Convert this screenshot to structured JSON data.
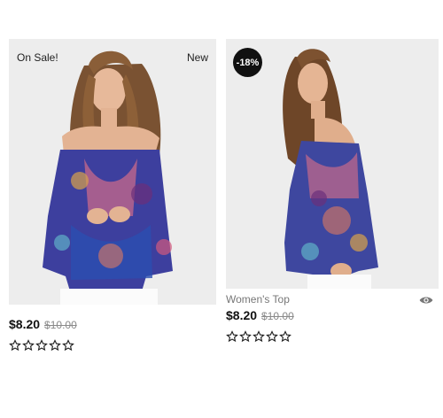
{
  "products": [
    {
      "badge_left": "On Sale!",
      "badge_right": "New",
      "title": "",
      "price": "$8.20",
      "old_price": "$10.00",
      "rating": 0,
      "rating_max": 5
    },
    {
      "discount": "-18%",
      "title": "Women's Top",
      "price": "$8.20",
      "old_price": "$10.00",
      "rating": 0,
      "rating_max": 5
    }
  ],
  "icons": {
    "quick_view": "eye-icon",
    "rating": "star-outline-icon"
  },
  "colors": {
    "badge_bg": "#111111",
    "price": "#111111",
    "old_price": "#8a8a8a"
  }
}
